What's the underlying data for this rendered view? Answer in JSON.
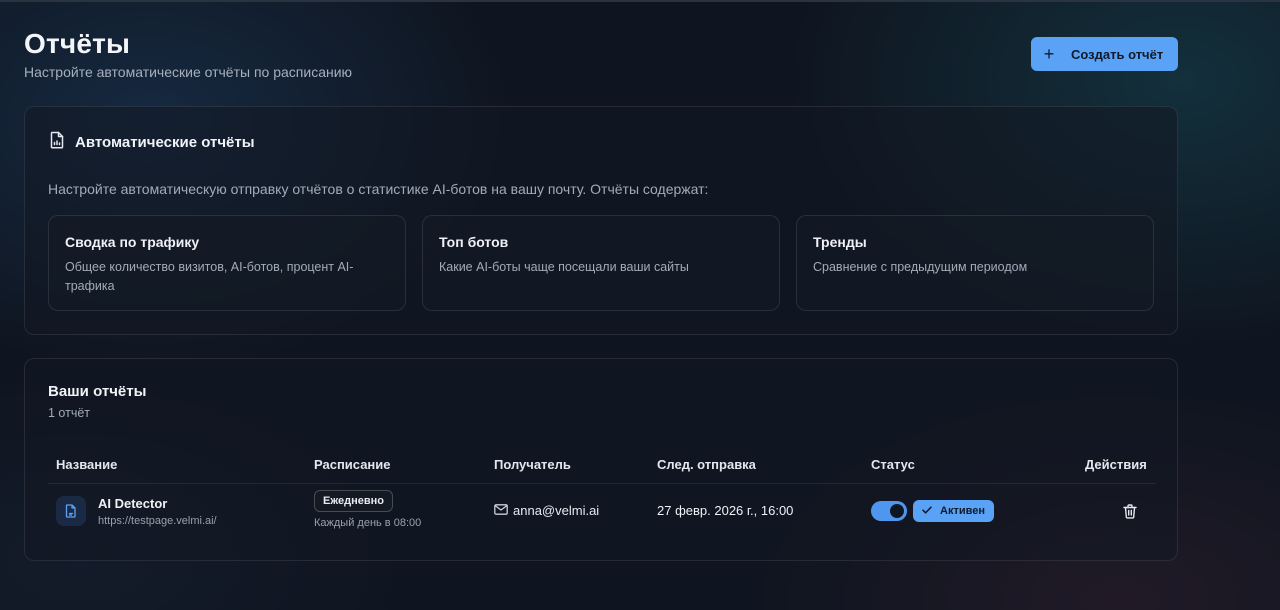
{
  "header": {
    "title": "Отчёты",
    "subtitle": "Настройте автоматические отчёты по расписанию",
    "create_button": {
      "label": "Создать отчёт",
      "icon": "plus-icon"
    }
  },
  "auto_reports": {
    "icon": "report-document-icon",
    "title": "Автоматические отчёты",
    "description": "Настройте автоматическую отправку отчётов о статистике AI-ботов на вашу почту. Отчёты содержат:",
    "features": [
      {
        "title": "Сводка по трафику",
        "description": "Общее количество визитов, AI-ботов, процент AI-трафика"
      },
      {
        "title": "Топ ботов",
        "description": "Какие AI-боты чаще посещали ваши сайты"
      },
      {
        "title": "Тренды",
        "description": "Сравнение с предыдущим периодом"
      }
    ]
  },
  "your_reports": {
    "title": "Ваши отчёты",
    "count": "1 отчёт",
    "columns": {
      "name": "Название",
      "schedule": "Расписание",
      "recipient": "Получатель",
      "next_send": "След. отправка",
      "status": "Статус",
      "actions": "Действия"
    },
    "rows": [
      {
        "icon": "document-icon",
        "name": "AI Detector",
        "url": "https://testpage.velmi.ai/",
        "schedule_badge": "Ежедневно",
        "schedule_detail": "Каждый день в 08:00",
        "recipient_icon": "mail-icon",
        "recipient": "anna@velmi.ai",
        "next_send": "27 февр. 2026 г., 16:00",
        "toggle_on": true,
        "status": "Активен",
        "status_icon": "check-icon",
        "action_icon": "trash-icon"
      }
    ]
  },
  "colors": {
    "accent": "#5aa2f5",
    "background": "#0f1520",
    "muted_text": "#a3abb8"
  }
}
